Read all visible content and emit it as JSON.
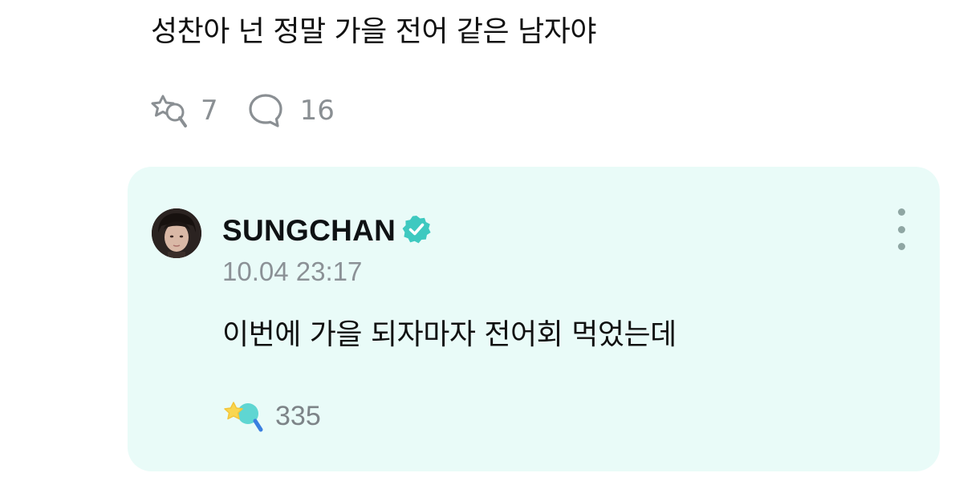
{
  "post": {
    "text": "성찬아 넌 정말 가을 전어 같은 남자야",
    "cheer_count": "7",
    "comment_count": "16"
  },
  "reply": {
    "author": "SUNGCHAN",
    "verified": true,
    "timestamp": "10.04 23:17",
    "text": "이번에 가을 되자마자 전어회 먹었는데",
    "reaction_count": "335"
  },
  "colors": {
    "reply_background": "#e9fbf8",
    "verified_badge": "#3ec9c0",
    "muted_text": "#8a8f93"
  },
  "icons": {
    "cheer": "cheer-icon",
    "comment": "comment-bubble-icon",
    "verified": "verified-badge-icon",
    "more": "more-vertical-icon",
    "reaction": "cheer-reaction-icon"
  }
}
